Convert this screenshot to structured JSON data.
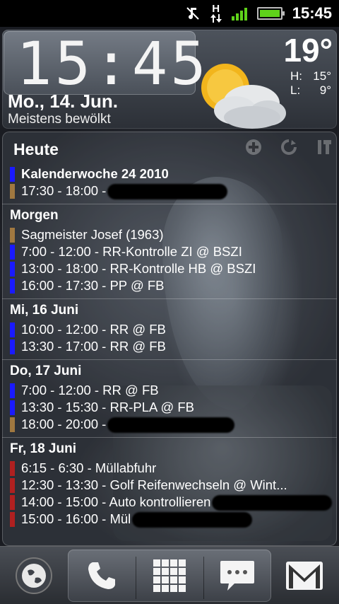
{
  "status_bar": {
    "time": "15:45",
    "network_type": "H",
    "icons": [
      "music-note-off-icon",
      "hsdpa-data-icon",
      "signal-strength-icon",
      "battery-icon"
    ],
    "battery_color": "#5fd21a"
  },
  "clock_widget": {
    "time": "15:45",
    "date": "Mo., 14. Jun.",
    "condition": "Meistens bewölkt",
    "temperature": "19°",
    "high_label": "H:",
    "high_value": "15°",
    "low_label": "L:",
    "low_value": "9°",
    "weather_icon": "partly-cloudy-icon"
  },
  "calendar": {
    "title": "Heute",
    "tool_icons": [
      "add-icon",
      "refresh-icon",
      "settings-icon"
    ],
    "today_events": [
      {
        "text": "Kalenderwoche 24 2010",
        "color": "#1a1aff",
        "bold": true,
        "redacted": false
      },
      {
        "text": "17:30 - 18:00 -",
        "color": "#a07840",
        "bold": false,
        "redacted": true
      }
    ],
    "days": [
      {
        "label": "Morgen",
        "events": [
          {
            "text": "Sagmeister Josef (1963)",
            "color": "#a07840",
            "redacted": false
          },
          {
            "text": "7:00 - 12:00 - RR-Kontrolle ZI @ BSZI",
            "color": "#1a1aff",
            "redacted": false
          },
          {
            "text": "13:00 - 18:00 - RR-Kontrolle HB @ BSZI",
            "color": "#1a1aff",
            "redacted": false
          },
          {
            "text": "16:00 - 17:30 - PP @ FB",
            "color": "#1a1aff",
            "redacted": false
          }
        ]
      },
      {
        "label": "Mi, 16 Juni",
        "events": [
          {
            "text": "10:00 - 12:00 - RR @ FB",
            "color": "#1a1aff",
            "redacted": false
          },
          {
            "text": "13:30 - 17:00 - RR @ FB",
            "color": "#1a1aff",
            "redacted": false
          }
        ]
      },
      {
        "label": "Do, 17 Juni",
        "events": [
          {
            "text": "7:00 - 12:00 - RR @ FB",
            "color": "#1a1aff",
            "redacted": false
          },
          {
            "text": "13:30 - 15:30 - RR-PLA @ FB",
            "color": "#1a1aff",
            "redacted": false
          },
          {
            "text": "18:00 - 20:00 -",
            "color": "#a07840",
            "redacted": true
          }
        ]
      },
      {
        "label": "Fr, 18 Juni",
        "events": [
          {
            "text": "6:15 - 6:30 - Müllabfuhr",
            "color": "#b02020",
            "redacted": false
          },
          {
            "text": "12:30 - 13:30 - Golf Reifenwechseln @ Wint...",
            "color": "#b02020",
            "redacted": false
          },
          {
            "text": "14:00 - 15:00 - Auto kontrollieren",
            "color": "#b02020",
            "redacted": true
          },
          {
            "text": "15:00 - 16:00 - Mül",
            "color": "#b02020",
            "redacted": true
          }
        ]
      }
    ]
  },
  "dock": {
    "items": [
      "browser-globe-icon",
      "phone-icon",
      "app-drawer-grid-icon",
      "messaging-icon",
      "gmail-icon"
    ]
  }
}
